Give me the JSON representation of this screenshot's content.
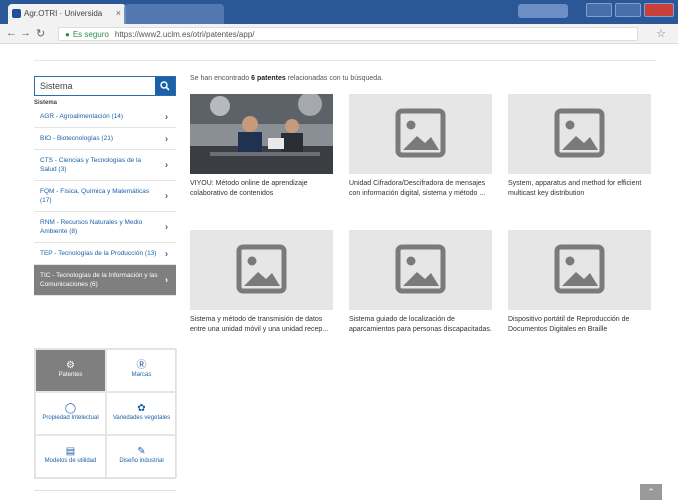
{
  "browser": {
    "tab_title": "Agr.OTRI · Universida",
    "tab_close": "×",
    "secure_label": "Es seguro",
    "url": "https://www2.uclm.es/otri/patentes/app/"
  },
  "sidebar": {
    "search_value": "Sistema",
    "search_placeholder": "Sistema",
    "heading": "Sistema",
    "categories": [
      {
        "label": "AGR - Agroalimentación (14)"
      },
      {
        "label": "BIO - Biotecnologías (21)"
      },
      {
        "label": "CTS - Ciencias y Tecnologías de la Salud (3)"
      },
      {
        "label": "FQM - Física, Química y Matemáticas (17)"
      },
      {
        "label": "RNM - Recursos Naturales y Medio Ambiente (8)"
      },
      {
        "label": "TEP - Tecnologías de la Producción (13)"
      },
      {
        "label": "TIC - Tecnologías de la Información y las Comunicaciones (6)"
      }
    ],
    "types": [
      {
        "label": "Patentes",
        "icon": "patents-icon"
      },
      {
        "label": "Marcas",
        "icon": "trademark-icon"
      },
      {
        "label": "Propiedad Intelectual",
        "icon": "bulb-icon"
      },
      {
        "label": "Variedades vegetales",
        "icon": "leaf-icon"
      },
      {
        "label": "Modelos de utilidad",
        "icon": "stack-icon"
      },
      {
        "label": "Diseño industrial",
        "icon": "design-icon"
      }
    ]
  },
  "main": {
    "summary_pre": "Se han encontrado ",
    "summary_bold": "6 patentes",
    "summary_post": " relacionadas con tu búsqueda.",
    "results": [
      {
        "title": "VIYOU: Método online de aprendizaje colaborativo de contenidos",
        "image": "photo"
      },
      {
        "title": "Unidad Cifradora/Descifradora de mensajes con información digital, sistema y método ...",
        "image": "placeholder"
      },
      {
        "title": "System, apparatus and method for efficient multicast key distribution",
        "image": "placeholder"
      },
      {
        "title": "Sistema y método de transmisión de datos entre una unidad móvil y una unidad recep...",
        "image": "placeholder"
      },
      {
        "title": "Sistema guiado de localización de aparcamientos para personas discapacitadas.",
        "image": "placeholder"
      },
      {
        "title": "Dispositivo portátil de Reproducción de Documentos Digitales en Braille",
        "image": "placeholder"
      }
    ]
  },
  "colors": {
    "brand": "#1b61a8",
    "active": "#7f7f7f",
    "titlebar": "#2b5797"
  }
}
